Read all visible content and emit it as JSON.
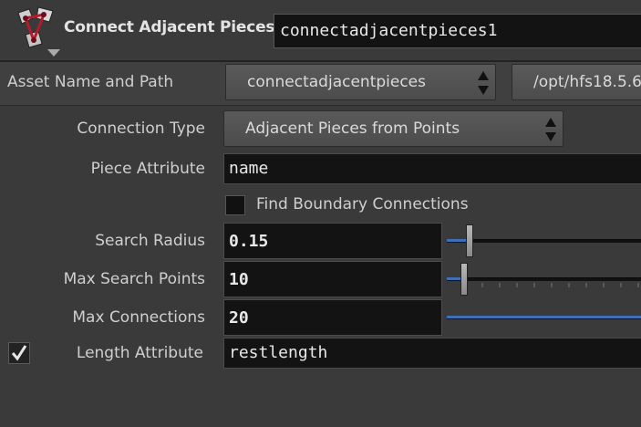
{
  "node": {
    "type_name": "Connect Adjacent Pieces",
    "name_value": "connectadjacentpieces1"
  },
  "asset": {
    "label": "Asset Name and Path",
    "name_value": "connectadjacentpieces",
    "path_value": "/opt/hfs18.5.6"
  },
  "params": {
    "connection_type": {
      "label": "Connection Type",
      "value": "Adjacent Pieces from Points"
    },
    "piece_attribute": {
      "label": "Piece Attribute",
      "value": "name"
    },
    "find_boundary": {
      "label": "Find Boundary Connections",
      "checked": false
    },
    "search_radius": {
      "label": "Search Radius",
      "value": "0.15",
      "slider_fraction": 0.1
    },
    "max_search_points": {
      "label": "Max Search Points",
      "value": "10",
      "slider_fraction": 0.07
    },
    "max_connections": {
      "label": "Max Connections",
      "value": "20",
      "slider_fraction": 1.0
    },
    "length_attribute": {
      "label": "Length Attribute",
      "value": "restlength",
      "enabled": true
    }
  },
  "colors": {
    "background": "#3a3a3a",
    "field_bg": "#131313",
    "slider_accent": "#3f6fb7"
  },
  "icons": {
    "node_icon": "connect-pieces-node-icon",
    "menu_arrows": "up-down-arrows-icon",
    "toggle": "checkmark-icon"
  }
}
